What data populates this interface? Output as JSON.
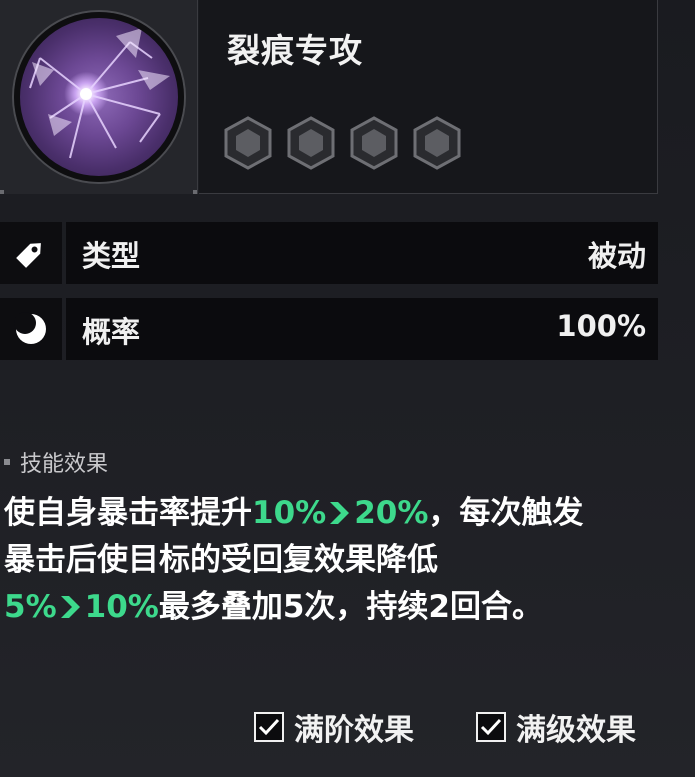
{
  "skill": {
    "title": "裂痕专攻",
    "icon": "purple-cracked-orb-icon",
    "rank_slots": 4
  },
  "info_rows": [
    {
      "icon": "tag-icon",
      "label": "类型",
      "value": "被动"
    },
    {
      "icon": "moon-icon",
      "label": "概率",
      "value": "100%"
    }
  ],
  "effect": {
    "heading": "技能效果",
    "line1_prefix": "使自身暴击率提升",
    "line1_from": "10%",
    "line1_to": "20%",
    "line1_suffix": "，每次触发",
    "line2": "暴击后使目标的受回复效果降低",
    "line3_from": "5%",
    "line3_to": "10%",
    "line3_suffix": "最多叠加5次，持续2回合。"
  },
  "toggles": {
    "max_rank_label": "满阶效果",
    "max_rank_checked": true,
    "max_level_label": "满级效果",
    "max_level_checked": true
  },
  "colors": {
    "highlight": "#3dd98c",
    "background": "#1c1d22",
    "row_background": "#0b0b0e"
  }
}
